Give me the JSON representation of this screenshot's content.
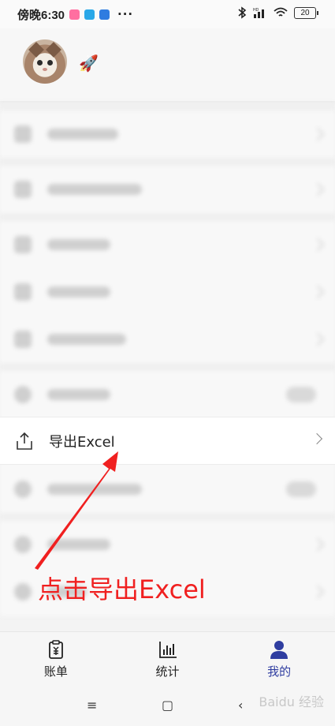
{
  "status_bar": {
    "time": "傍晚6:30",
    "dots": "···",
    "signal_text": "HD",
    "battery": "20"
  },
  "export_row": {
    "label": "导出Excel",
    "icon": "share-export-icon"
  },
  "annotation": {
    "text": "点击导出Excel",
    "color": "#f02020"
  },
  "tabs": [
    {
      "label": "账单",
      "icon": "bill-icon"
    },
    {
      "label": "统计",
      "icon": "chart-icon"
    },
    {
      "label": "我的",
      "icon": "profile-icon",
      "active": true
    }
  ],
  "nav": {
    "menu": "≡",
    "home": "▢",
    "back": "‹"
  },
  "watermark": "Baidu 经验",
  "colors": {
    "accent": "#2f3da0",
    "annotation": "#f02020"
  }
}
